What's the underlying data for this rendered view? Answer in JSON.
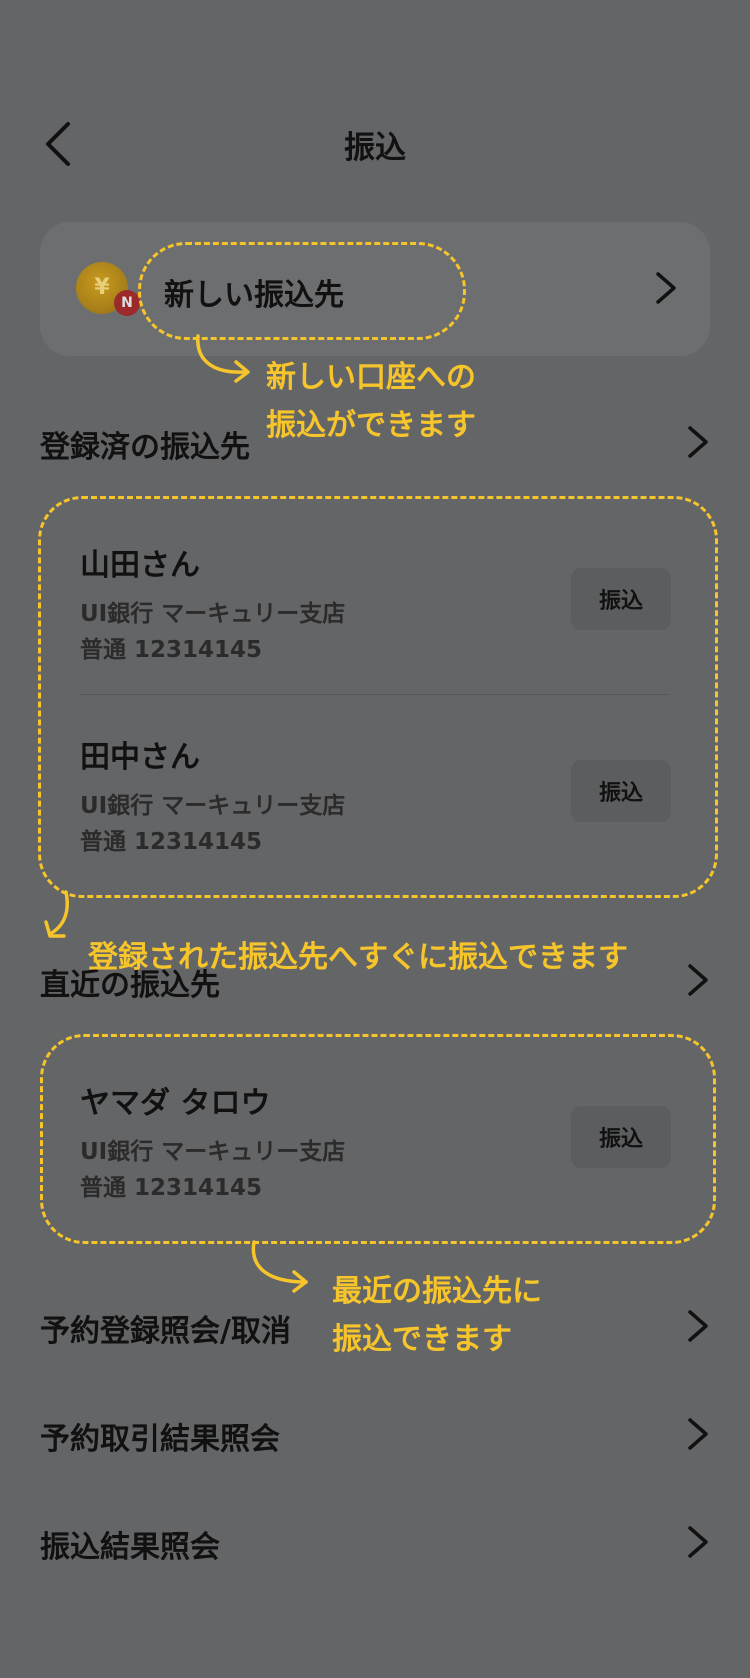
{
  "header": {
    "title": "振込",
    "back_icon": "chevron-left-icon"
  },
  "new_payee": {
    "label": "新しい振込先",
    "coin_symbol": "¥",
    "badge": "N"
  },
  "sections": {
    "registered": "登録済の振込先",
    "recent": "直近の振込先",
    "reservations": "予約登録照会/取消",
    "reservation_results": "予約取引結果照会",
    "transfer_results": "振込結果照会"
  },
  "registered_payees": [
    {
      "name": "山田さん",
      "bank": "UI銀行 マーキュリー支店",
      "account": "普通 12314145",
      "button": "振込"
    },
    {
      "name": "田中さん",
      "bank": "UI銀行 マーキュリー支店",
      "account": "普通 12314145",
      "button": "振込"
    }
  ],
  "recent_payees": [
    {
      "name": "ヤマダ タロウ",
      "bank": "UI銀行 マーキュリー支店",
      "account": "普通 12314145",
      "button": "振込"
    }
  ],
  "annotations": {
    "new_line1": "新しい口座への",
    "new_line2": "振込ができます",
    "registered": "登録された振込先へすぐに振込できます",
    "recent_line1": "最近の振込先に",
    "recent_line2": "振込できます"
  },
  "colors": {
    "background": "#646567",
    "card": "#6d6e70",
    "annotation": "#f6c42b"
  }
}
